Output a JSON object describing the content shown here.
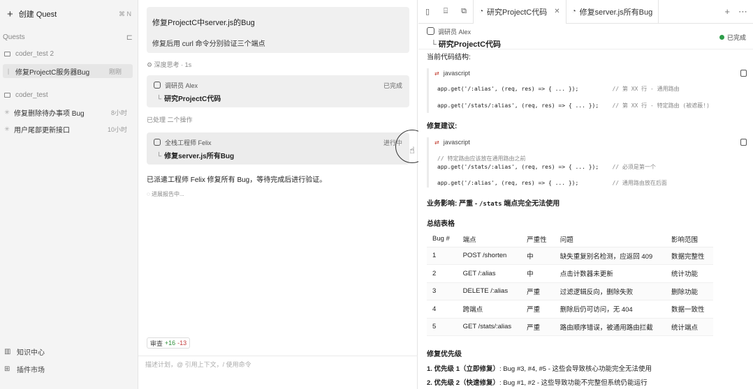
{
  "sidebar": {
    "new_quest_label": "创建 Quest",
    "new_quest_shortcut": "⌘ N",
    "quests_header": "Quests",
    "groups": [
      {
        "name": "coder_test 2",
        "items": [
          {
            "title": "修复ProjectC服务器Bug",
            "time": "刚刚",
            "active": true
          }
        ]
      },
      {
        "name": "coder_test",
        "items": [
          {
            "title": "修复删除待办事项 Bug",
            "time": "8小时",
            "active": false
          },
          {
            "title": "用户尾部更新接口",
            "time": "10小时",
            "active": false
          }
        ]
      }
    ],
    "bottom": {
      "knowledge": "知识中心",
      "plugins": "插件市场"
    }
  },
  "chat": {
    "user_message": {
      "title": "修复ProjectC中server.js的Bug",
      "body": "修复后用 curl 命令分别验证三个端点"
    },
    "thought": "深度思考 · 1s",
    "agent_card_1": {
      "role": "调研员 Alex",
      "status": "已完成",
      "task": "研究ProjectC代码"
    },
    "processed_label": "已处理 二个操作",
    "agent_card_2": {
      "role": "全栈工程师 Felix",
      "status": "进行中",
      "task": "修复server.js所有Bug"
    },
    "dispatch_text": "已派遣工程师 Felix 修复所有 Bug，等待完成后进行验证。",
    "thinking_text": "进展报告中...",
    "review": {
      "label": "审查",
      "added": "+16",
      "removed": "-13"
    },
    "composer_placeholder": "描述计划，@ 引用上下文，/ 使用命令"
  },
  "right": {
    "tabs": [
      {
        "label": "研究ProjectC代码",
        "active": true
      },
      {
        "label": "修复server.js所有Bug",
        "active": false
      }
    ],
    "header": {
      "role": "调研员 Alex",
      "task": "研究ProjectC代码",
      "status": "已完成"
    },
    "current_section_label": "当前代码结构:",
    "code1": {
      "lang": "javascript",
      "lines": [
        {
          "code": "app.get('/:alias', (req, res) => { ... });",
          "comment": "// 第 XX 行 - 通用路由"
        },
        {
          "code": "app.get('/stats/:alias', (req, res) => { ... });",
          "comment": "// 第 XX 行 - 特定路由 (被遮蔽!)"
        }
      ]
    },
    "fix_section_label": "修复建议:",
    "code2": {
      "lang": "javascript",
      "lines": [
        {
          "code": "// 特定路由应该放在通用路由之前",
          "comment": ""
        },
        {
          "code": "app.get('/stats/:alias', (req, res) => { ... });",
          "comment": "// 必须是第一个"
        },
        {
          "code": "app.get('/:alias', (req, res) => { ... });",
          "comment": "// 通用路由放在后面"
        }
      ]
    },
    "business_impact": {
      "label": "业务影响:",
      "severity": "严重 - ",
      "endpoint": "/stats",
      "tail": " 端点完全无法使用"
    },
    "summary_label": "总结表格",
    "table": {
      "headers": [
        "Bug #",
        "端点",
        "严重性",
        "问题",
        "影响范围"
      ],
      "rows": [
        [
          "1",
          "POST /shorten",
          "中",
          "缺失重复别名检测，应返回 409",
          "数据完整性"
        ],
        [
          "2",
          "GET /:alias",
          "中",
          "点击计数器未更新",
          "统计功能"
        ],
        [
          "3",
          "DELETE /:alias",
          "严重",
          "过滤逻辑反向，删除失败",
          "删除功能"
        ],
        [
          "4",
          "跨端点",
          "严重",
          "删除后仍可访问，无 404",
          "数据一致性"
        ],
        [
          "5",
          "GET /stats/:alias",
          "严重",
          "路由顺序错误，被通用路由拦截",
          "统计端点"
        ]
      ]
    },
    "priority_label": "修复优先级",
    "priorities": [
      {
        "label": "1. 优先级 1（立即修复）",
        "text": ": Bug #3, #4, #5 - 这些会导致核心功能完全无法使用"
      },
      {
        "label": "2. 优先级 2（快速修复）",
        "text": ": Bug #1, #2 - 这些导致功能不完整但系统仍能运行"
      }
    ]
  }
}
